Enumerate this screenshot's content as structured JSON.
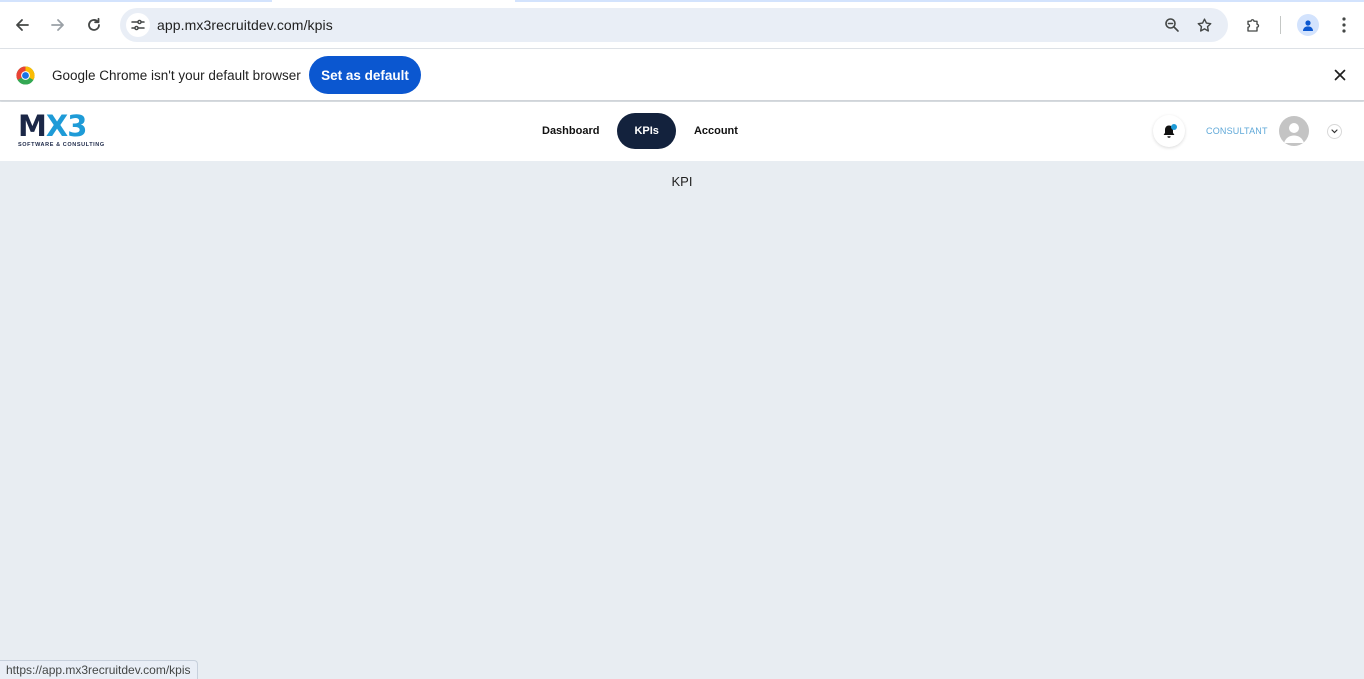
{
  "browser": {
    "url": "app.mx3recruitdev.com/kpis",
    "icons": {
      "back": "arrow-left-icon",
      "forward": "arrow-right-icon",
      "reload": "reload-icon",
      "site_info": "tune-icon",
      "zoom": "zoom-icon",
      "bookmark": "star-icon",
      "extensions": "puzzle-icon",
      "profile": "person-icon",
      "menu": "kebab-menu-icon"
    }
  },
  "infobar": {
    "message": "Google Chrome isn't your default browser",
    "button_label": "Set as default",
    "close_icon": "close-icon"
  },
  "app": {
    "logo": {
      "brand_m": "M",
      "brand_x": "X",
      "brand_3": "3",
      "tagline": "SOFTWARE & CONSULTING"
    },
    "nav": {
      "items": [
        {
          "label": "Dashboard",
          "active": false
        },
        {
          "label": "KPIs",
          "active": true
        },
        {
          "label": "Account",
          "active": false
        }
      ]
    },
    "user": {
      "role": "CONSULTANT",
      "bell_icon": "bell-icon",
      "avatar_icon": "avatar-icon",
      "menu_icon": "chevron-down-icon"
    },
    "colors": {
      "brand_navy": "#13223d",
      "brand_blue": "#1e9bd7",
      "page_bg": "#e8edf2",
      "chrome_blue": "#0b57d0"
    }
  },
  "main": {
    "title": "KPI"
  },
  "status_bar": {
    "link_url": "https://app.mx3recruitdev.com/kpis"
  }
}
